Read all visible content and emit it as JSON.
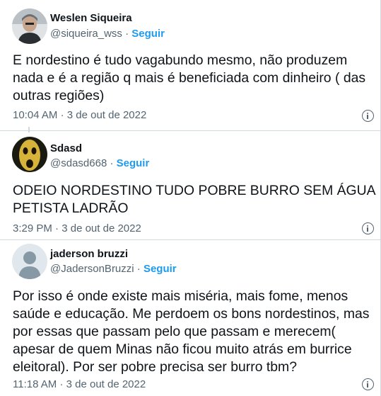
{
  "tweets": [
    {
      "name": "Weslen Siqueira",
      "handle": "@siqueira_wss",
      "follow_label": "Seguir",
      "separator": "·",
      "text": "E nordestino é tudo vagabundo mesmo, não produzem nada e é a região q mais é beneficiada com dinheiro ( das outras regiões)",
      "time": "10:04 AM",
      "date": "3 de out de 2022",
      "info_icon": "info-icon"
    },
    {
      "name": "Sdasd",
      "handle": "@sdasd668",
      "follow_label": "Seguir",
      "separator": "·",
      "text": "ODEIO NORDESTINO TUDO POBRE BURRO SEM ÁGUA PETISTA LADRÃO",
      "time": "3:29 PM",
      "date": "3 de out de 2022",
      "info_icon": "info-icon"
    },
    {
      "name": "jaderson bruzzi",
      "handle": "@JadersonBruzzi",
      "follow_label": "Seguir",
      "separator": "·",
      "text": "Por isso é onde existe mais miséria, mais fome, menos saúde e educação. Me perdoem os bons nordestinos, mas por essas que passam pelo que passam e merecem( apesar de quem Minas  não ficou muito atrás em burrice eleitoral). Por ser pobre precisa ser burro tbm?",
      "time": "11:18 AM",
      "date": "3 de out de 2022",
      "info_icon": "info-icon"
    }
  ],
  "meta_separator": "·",
  "colors": {
    "text": "#0f1419",
    "secondary": "#536471",
    "accent": "#1d9bf0",
    "border": "#cfd9de"
  }
}
